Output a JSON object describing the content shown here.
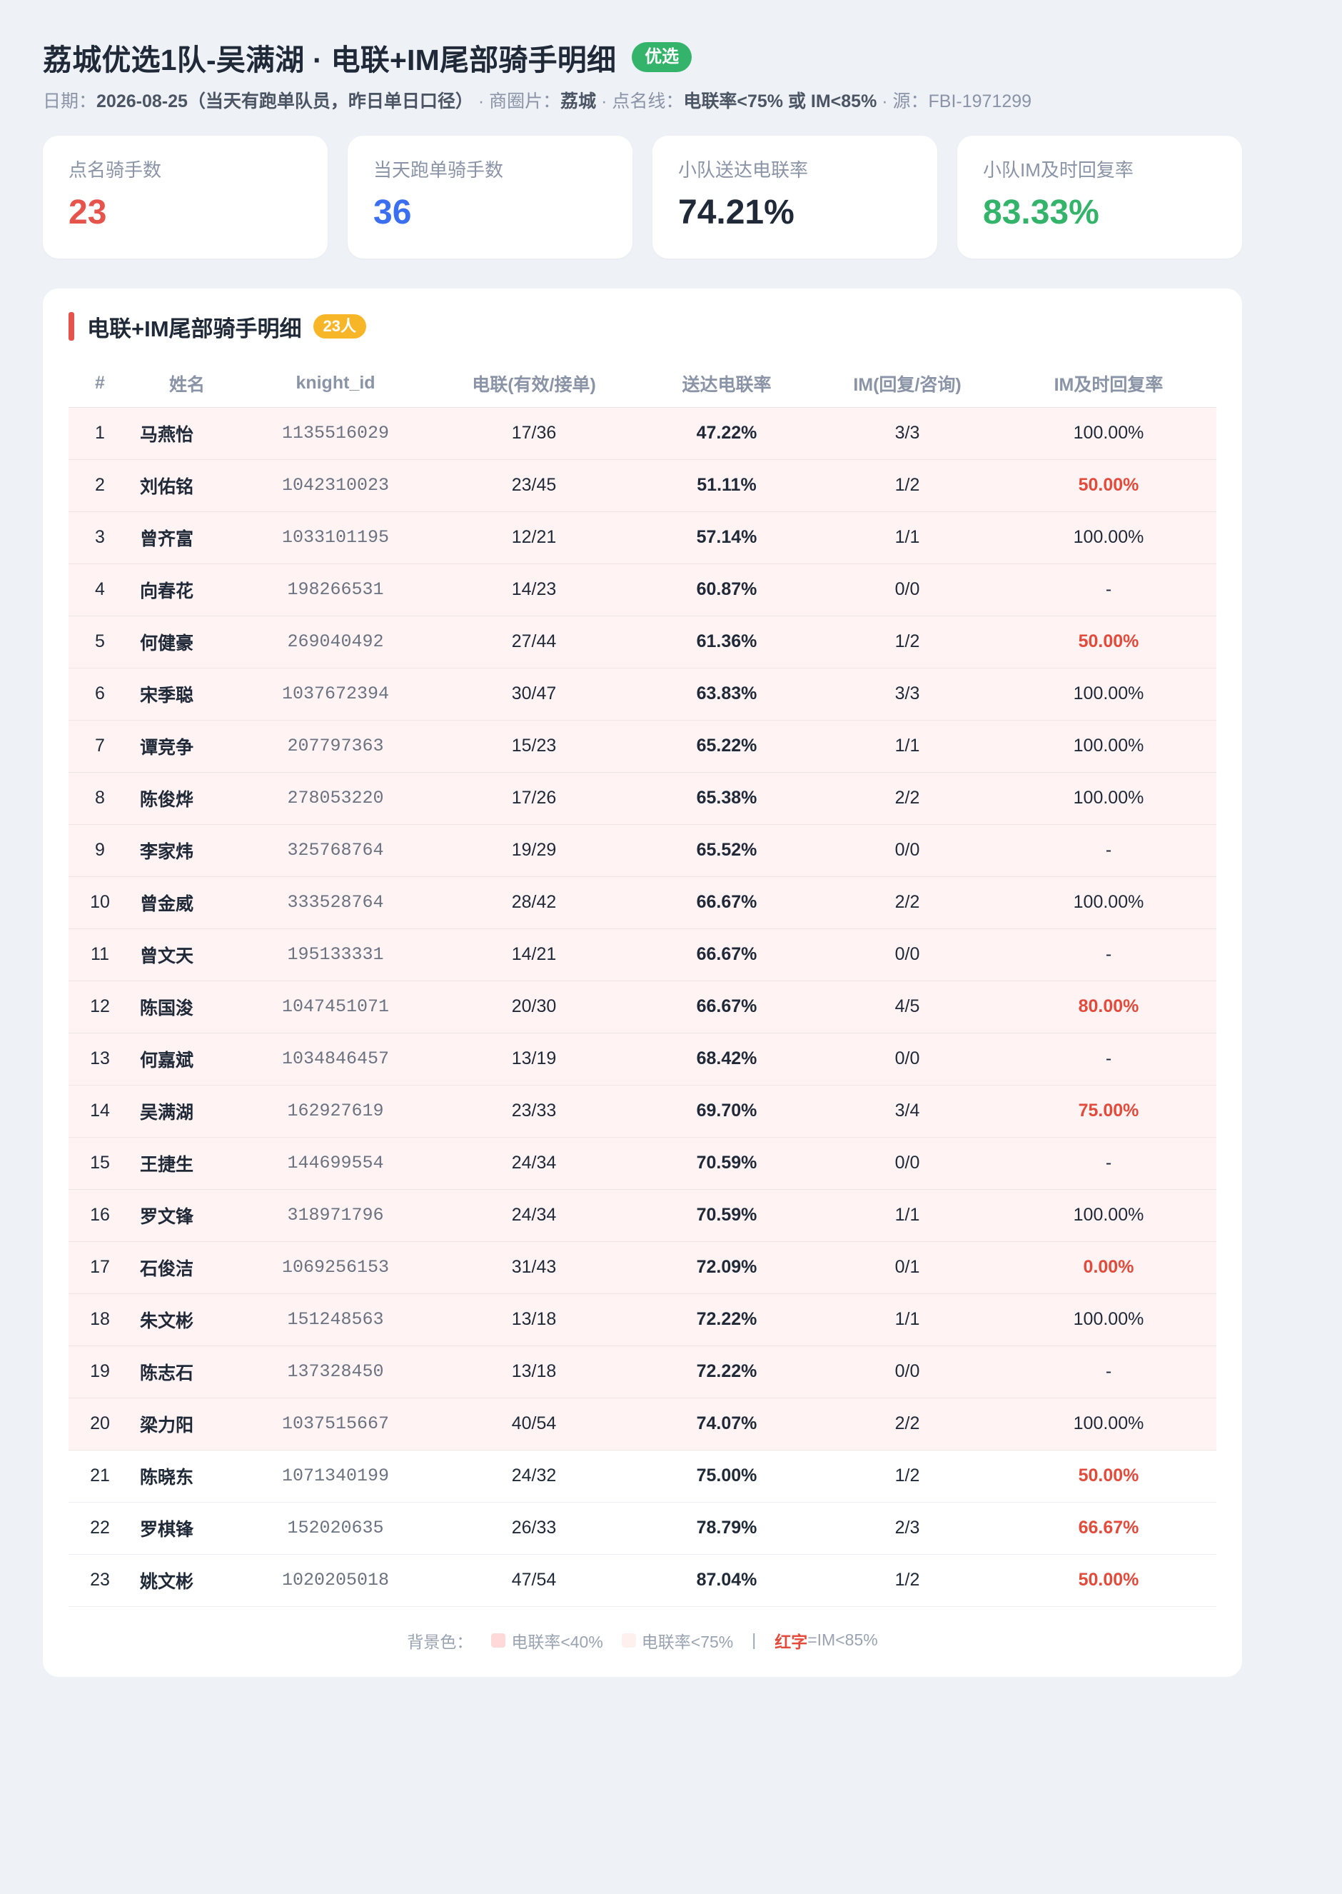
{
  "header": {
    "title": "荔城优选1队-吴满湖 · 电联+IM尾部骑手明细",
    "badge": "优选",
    "date_label": "日期：",
    "date_value": "2026-08-25（当天有跑单队员，昨日单日口径）",
    "sep1": " · 商圈片：",
    "area_value": "荔城",
    "sep2": " · 点名线：",
    "line_value": "电联率<75% 或 IM<85%",
    "sep3": " · 源：FBI-1971299"
  },
  "cards": [
    {
      "label": "点名骑手数",
      "value": "23",
      "color": "#e5534b"
    },
    {
      "label": "当天跑单骑手数",
      "value": "36",
      "color": "#3b6ff0"
    },
    {
      "label": "小队送达电联率",
      "value": "74.21%",
      "color": "#1f2937"
    },
    {
      "label": "小队IM及时回复率",
      "value": "83.33%",
      "color": "#34b46a"
    }
  ],
  "panel": {
    "title": "电联+IM尾部骑手明细",
    "count_badge": "23人"
  },
  "table": {
    "headers": [
      "#",
      "姓名",
      "knight_id",
      "电联(有效/接单)",
      "送达电联率",
      "IM(回复/咨询)",
      "IM及时回复率"
    ],
    "rows": [
      {
        "no": "1",
        "name": "马燕怡",
        "kid": "1135516029",
        "call": "17/36",
        "rate": "47.22%",
        "im": "3/3",
        "im_rate": "100.00%",
        "im_red": false,
        "warn": true
      },
      {
        "no": "2",
        "name": "刘佑铭",
        "kid": "1042310023",
        "call": "23/45",
        "rate": "51.11%",
        "im": "1/2",
        "im_rate": "50.00%",
        "im_red": true,
        "warn": true
      },
      {
        "no": "3",
        "name": "曾齐富",
        "kid": "1033101195",
        "call": "12/21",
        "rate": "57.14%",
        "im": "1/1",
        "im_rate": "100.00%",
        "im_red": false,
        "warn": true
      },
      {
        "no": "4",
        "name": "向春花",
        "kid": "198266531",
        "call": "14/23",
        "rate": "60.87%",
        "im": "0/0",
        "im_rate": "-",
        "im_red": false,
        "warn": true
      },
      {
        "no": "5",
        "name": "何健豪",
        "kid": "269040492",
        "call": "27/44",
        "rate": "61.36%",
        "im": "1/2",
        "im_rate": "50.00%",
        "im_red": true,
        "warn": true
      },
      {
        "no": "6",
        "name": "宋季聪",
        "kid": "1037672394",
        "call": "30/47",
        "rate": "63.83%",
        "im": "3/3",
        "im_rate": "100.00%",
        "im_red": false,
        "warn": true
      },
      {
        "no": "7",
        "name": "谭竞争",
        "kid": "207797363",
        "call": "15/23",
        "rate": "65.22%",
        "im": "1/1",
        "im_rate": "100.00%",
        "im_red": false,
        "warn": true
      },
      {
        "no": "8",
        "name": "陈俊烨",
        "kid": "278053220",
        "call": "17/26",
        "rate": "65.38%",
        "im": "2/2",
        "im_rate": "100.00%",
        "im_red": false,
        "warn": true
      },
      {
        "no": "9",
        "name": "李家炜",
        "kid": "325768764",
        "call": "19/29",
        "rate": "65.52%",
        "im": "0/0",
        "im_rate": "-",
        "im_red": false,
        "warn": true
      },
      {
        "no": "10",
        "name": "曾金威",
        "kid": "333528764",
        "call": "28/42",
        "rate": "66.67%",
        "im": "2/2",
        "im_rate": "100.00%",
        "im_red": false,
        "warn": true
      },
      {
        "no": "11",
        "name": "曾文天",
        "kid": "195133331",
        "call": "14/21",
        "rate": "66.67%",
        "im": "0/0",
        "im_rate": "-",
        "im_red": false,
        "warn": true
      },
      {
        "no": "12",
        "name": "陈国浚",
        "kid": "1047451071",
        "call": "20/30",
        "rate": "66.67%",
        "im": "4/5",
        "im_rate": "80.00%",
        "im_red": true,
        "warn": true
      },
      {
        "no": "13",
        "name": "何嘉斌",
        "kid": "1034846457",
        "call": "13/19",
        "rate": "68.42%",
        "im": "0/0",
        "im_rate": "-",
        "im_red": false,
        "warn": true
      },
      {
        "no": "14",
        "name": "吴满湖",
        "kid": "162927619",
        "call": "23/33",
        "rate": "69.70%",
        "im": "3/4",
        "im_rate": "75.00%",
        "im_red": true,
        "warn": true
      },
      {
        "no": "15",
        "name": "王捷生",
        "kid": "144699554",
        "call": "24/34",
        "rate": "70.59%",
        "im": "0/0",
        "im_rate": "-",
        "im_red": false,
        "warn": true
      },
      {
        "no": "16",
        "name": "罗文锋",
        "kid": "318971796",
        "call": "24/34",
        "rate": "70.59%",
        "im": "1/1",
        "im_rate": "100.00%",
        "im_red": false,
        "warn": true
      },
      {
        "no": "17",
        "name": "石俊洁",
        "kid": "1069256153",
        "call": "31/43",
        "rate": "72.09%",
        "im": "0/1",
        "im_rate": "0.00%",
        "im_red": true,
        "warn": true
      },
      {
        "no": "18",
        "name": "朱文彬",
        "kid": "151248563",
        "call": "13/18",
        "rate": "72.22%",
        "im": "1/1",
        "im_rate": "100.00%",
        "im_red": false,
        "warn": true
      },
      {
        "no": "19",
        "name": "陈志石",
        "kid": "137328450",
        "call": "13/18",
        "rate": "72.22%",
        "im": "0/0",
        "im_rate": "-",
        "im_red": false,
        "warn": true
      },
      {
        "no": "20",
        "name": "梁力阳",
        "kid": "1037515667",
        "call": "40/54",
        "rate": "74.07%",
        "im": "2/2",
        "im_rate": "100.00%",
        "im_red": false,
        "warn": true
      },
      {
        "no": "21",
        "name": "陈晓东",
        "kid": "1071340199",
        "call": "24/32",
        "rate": "75.00%",
        "im": "1/2",
        "im_rate": "50.00%",
        "im_red": true,
        "warn": false
      },
      {
        "no": "22",
        "name": "罗棋锋",
        "kid": "152020635",
        "call": "26/33",
        "rate": "78.79%",
        "im": "2/3",
        "im_rate": "66.67%",
        "im_red": true,
        "warn": false
      },
      {
        "no": "23",
        "name": "姚文彬",
        "kid": "1020205018",
        "call": "47/54",
        "rate": "87.04%",
        "im": "1/2",
        "im_rate": "50.00%",
        "im_red": true,
        "warn": false
      }
    ]
  },
  "legend": {
    "prefix": "背景色：",
    "item1": "电联率<40%",
    "item1_color": "#ffd9d9",
    "item2": "电联率<75%",
    "item2_color": "#fff0f0",
    "sep": "|",
    "red_word": "红字",
    "red_rest": "=IM<85%"
  }
}
